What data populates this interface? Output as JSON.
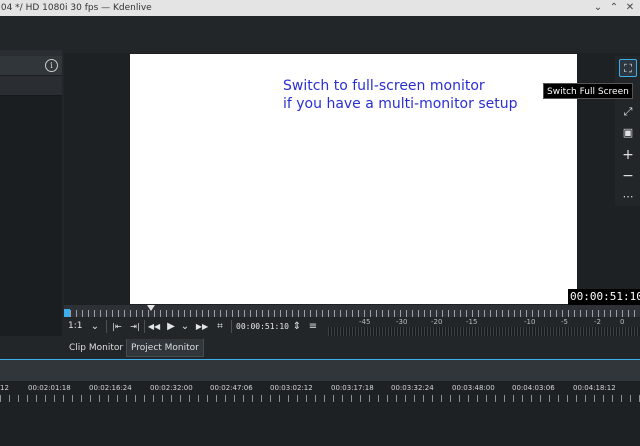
{
  "window": {
    "title": ".04 */ HD 1080i 30 fps — Kdenlive",
    "controls": {
      "minimize": "⌄",
      "maximize": "⌃",
      "close": "✕"
    }
  },
  "left_dock": {
    "info_icon": "i"
  },
  "monitor": {
    "overlay_lines": [
      "Switch to full-screen monitor",
      "if you have a multi-monitor setup"
    ],
    "tooltip": "Switch Full Screen",
    "timecode_overlay": "00:00:51:10",
    "side_toolbar": {
      "fullscreen": "⛶",
      "grid": "⋮⋮",
      "zoom_fit": "⤢",
      "safe_zone": "▣",
      "zoom_in": "+",
      "zoom_out": "−",
      "more": "⋯"
    }
  },
  "controls": {
    "zoom_label": "1:1",
    "zoom_dropdown": "⌄",
    "set_in": "|⇤",
    "set_out": "⇥|",
    "rewind": "◀◀",
    "play": "▶",
    "play_dropdown": "⌄",
    "forward": "▶▶",
    "crop": "⌗",
    "timecode": "00:00:51:10",
    "spinner": "⇕",
    "menu": "≡",
    "db_scale": [
      "-45",
      "-30",
      "-20",
      "-15",
      "-10",
      "-5",
      "-2",
      "0"
    ]
  },
  "tabs": [
    "Clip Monitor",
    "Project Monitor"
  ],
  "timeline": {
    "labels": [
      "12",
      "00:02:01:18",
      "00:02:16:24",
      "00:02:32:00",
      "00:02:47:06",
      "00:03:02:12",
      "00:03:17:18",
      "00:03:32:24",
      "00:03:48:00",
      "00:04:03:06",
      "00:04:18:12"
    ]
  },
  "colors": {
    "accent": "#3daee9",
    "overlay_text": "#2a2ed0",
    "background": "#232629"
  }
}
